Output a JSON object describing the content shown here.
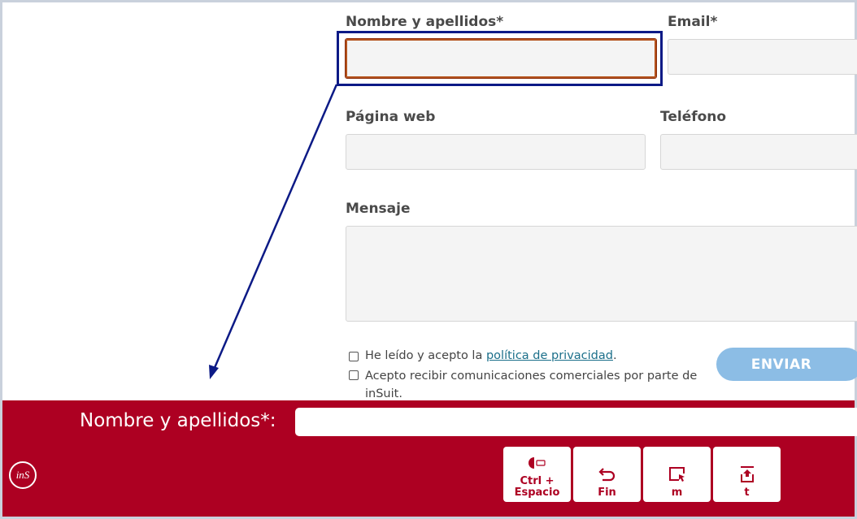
{
  "form": {
    "name_label": "Nombre y apellidos*",
    "email_label": "Email*",
    "web_label": "Página web",
    "phone_label": "Teléfono",
    "message_label": "Mensaje",
    "privacy_prefix": "He leído y acepto la ",
    "privacy_link": "política de privacidad",
    "privacy_suffix": ".",
    "commercial_text": "Acepto recibir comunicaciones comerciales por parte de inSuit.",
    "send_label": "ENVIAR"
  },
  "bar": {
    "field_label": "Nombre y apellidos*:",
    "logo_text": "inS",
    "keys": [
      {
        "label": "Ctrl +\nEspacio",
        "icon": "toggle-icon"
      },
      {
        "label": "Fin",
        "icon": "undo-arrow-icon"
      },
      {
        "label": "m",
        "icon": "window-cursor-icon"
      },
      {
        "label": "t",
        "icon": "upload-icon"
      }
    ]
  },
  "colors": {
    "bar": "#ad0022",
    "focus_outline": "#0c1a86",
    "send_button": "#8cbde5"
  }
}
